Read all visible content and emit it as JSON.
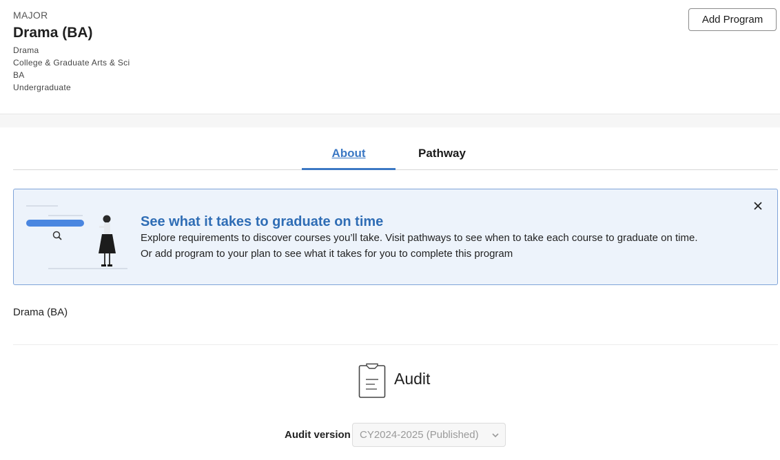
{
  "program": {
    "kind": "MAJOR",
    "title": "Drama (BA)",
    "department": "Drama",
    "college": "College & Graduate Arts & Sci",
    "degree": "BA",
    "level": "Undergraduate"
  },
  "actions": {
    "add_program": "Add Program"
  },
  "tabs": [
    {
      "label": "About",
      "active": true
    },
    {
      "label": "Pathway",
      "active": false
    }
  ],
  "banner": {
    "title": "See what it takes to graduate on time",
    "line1": "Explore requirements to discover courses you’ll take. Visit pathways to see when to take each course to graduate on time.",
    "line2": "Or add program to your plan to see what it takes for you to complete this program"
  },
  "program_name": "Drama (BA)",
  "audit": {
    "label": "Audit",
    "version_label": "Audit version",
    "version_value": "CY2024-2025 (Published)"
  },
  "colors": {
    "accent": "#3b78c4",
    "banner_bg": "#edf3fb",
    "banner_border": "#7ea3d8"
  }
}
